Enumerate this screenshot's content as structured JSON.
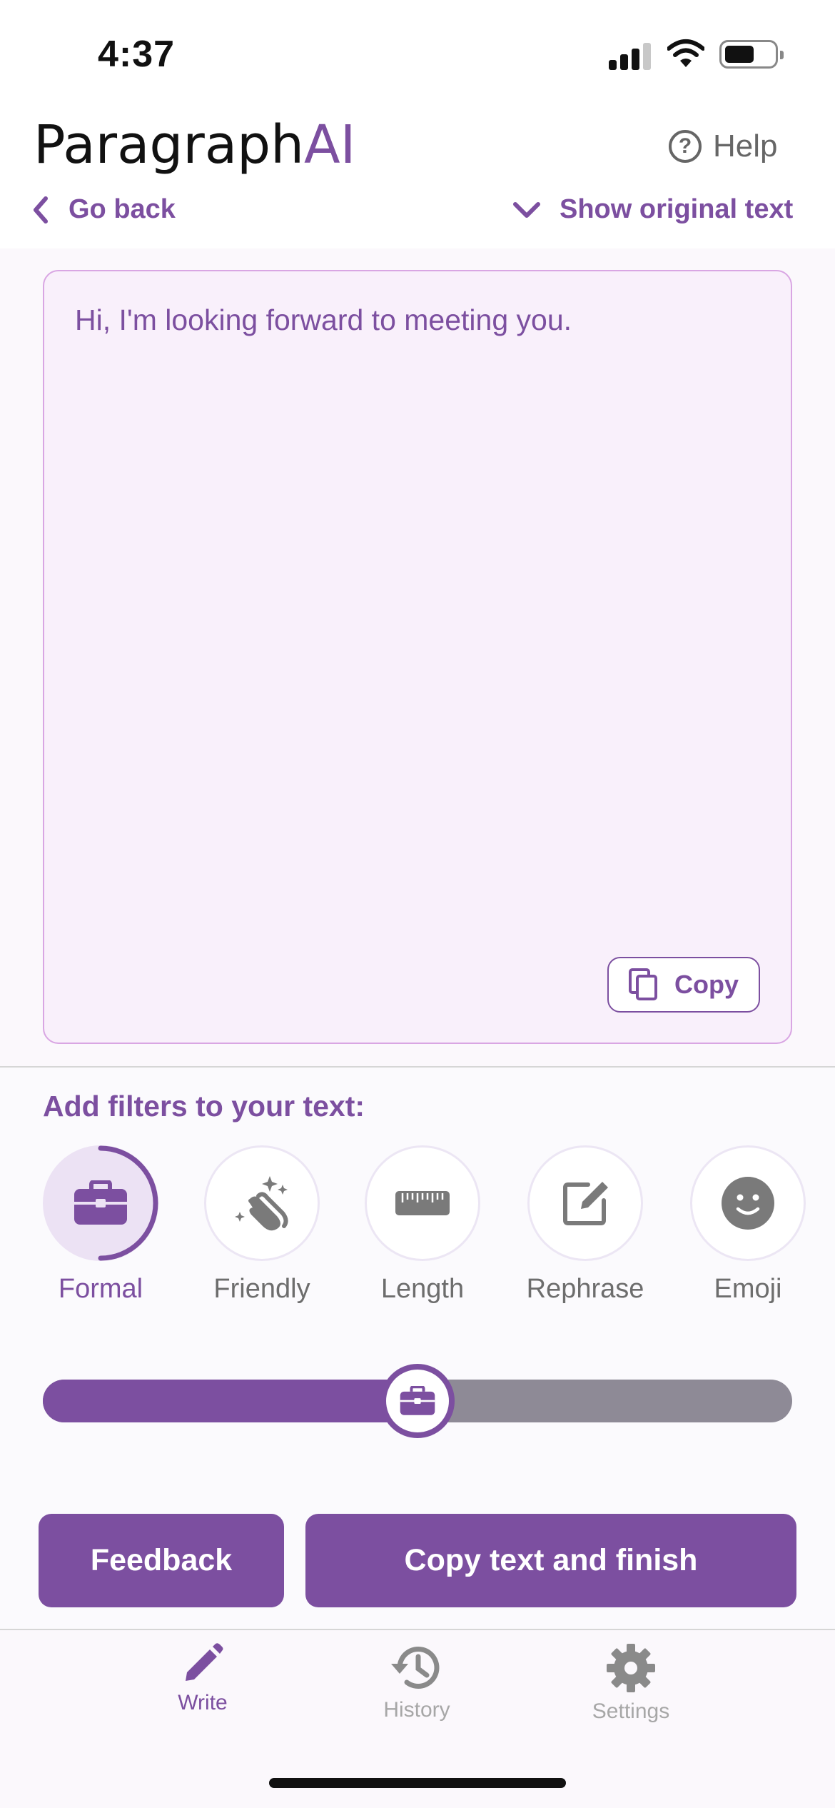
{
  "status_bar": {
    "time": "4:37"
  },
  "header": {
    "logo_main": "Paragraph",
    "logo_accent": "AI",
    "help_label": "Help",
    "back_label": "Go back",
    "show_original_label": "Show original text"
  },
  "editor": {
    "text": "Hi, I'm looking forward to meeting you.",
    "copy_label": "Copy"
  },
  "filters": {
    "title": "Add filters to your text:",
    "items": [
      {
        "label": "Formal",
        "icon": "briefcase-icon",
        "active": true
      },
      {
        "label": "Friendly",
        "icon": "clapping-hands-icon",
        "active": false
      },
      {
        "label": "Length",
        "icon": "ruler-icon",
        "active": false
      },
      {
        "label": "Rephrase",
        "icon": "edit-square-icon",
        "active": false
      },
      {
        "label": "Emoji",
        "icon": "smiley-icon",
        "active": false
      }
    ],
    "slider_level": 0.5
  },
  "actions": {
    "feedback_label": "Feedback",
    "finish_label": "Copy text and finish"
  },
  "tabbar": {
    "items": [
      {
        "label": "Write",
        "icon": "pencil-icon",
        "active": true
      },
      {
        "label": "History",
        "icon": "history-icon",
        "active": false
      },
      {
        "label": "Settings",
        "icon": "gear-icon",
        "active": false
      }
    ]
  },
  "colors": {
    "accent": "#7c4fa0",
    "inactive": "#8e8a96",
    "card_background": "#f9f0fb"
  }
}
